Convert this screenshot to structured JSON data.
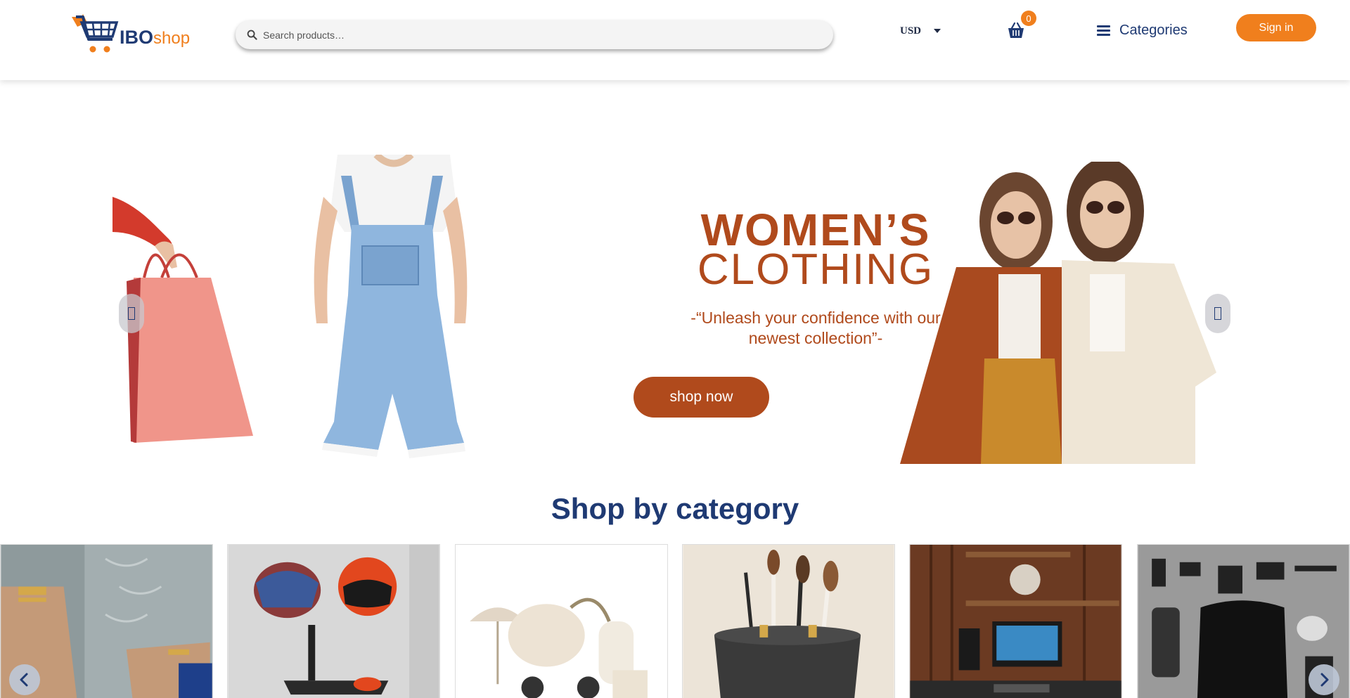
{
  "header": {
    "logo": {
      "brand": "IBO",
      "suffix": "shop"
    },
    "search": {
      "placeholder": "Search products…"
    },
    "currency": {
      "selected": "USD"
    },
    "cart": {
      "count": "0"
    },
    "categories_label": "Categories",
    "signin_label": "Sign in"
  },
  "hero": {
    "title_line1": "WOMEN’S",
    "title_line2": "CLOTHING",
    "quote": "-“Unleash your confidence with our newest collection”-",
    "cta_label": "shop now",
    "prev_glyph": "",
    "next_glyph": ""
  },
  "section": {
    "title": "Shop by category"
  },
  "categories": {
    "tiles": [
      {
        "icon": "jewelry-image"
      },
      {
        "icon": "helmet-rack-image"
      },
      {
        "icon": "stroller-image"
      },
      {
        "icon": "makeup-brushes-image"
      },
      {
        "icon": "desk-setup-image"
      },
      {
        "icon": "travel-gear-image"
      }
    ]
  },
  "colors": {
    "accent_orange": "#f07f1d",
    "brand_navy": "#1f3a73",
    "hero_rust": "#b04a1c"
  }
}
